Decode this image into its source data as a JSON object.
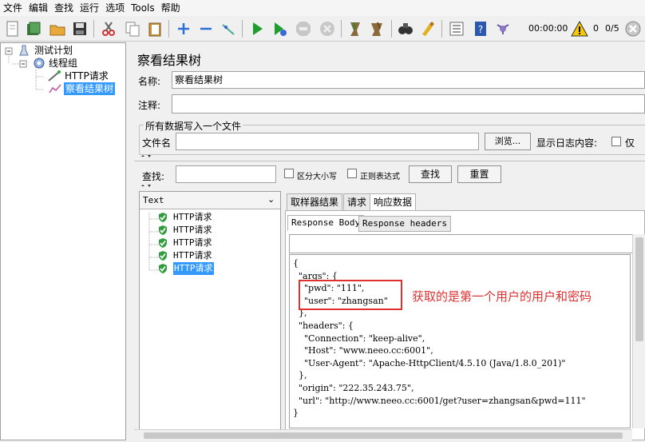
{
  "menu": [
    "文件",
    "编辑",
    "查找",
    "运行",
    "选项",
    "Tools",
    "帮助"
  ],
  "toolbar": {
    "timer": "00:00:00",
    "warnings": "0",
    "threads": "0/5"
  },
  "tree": {
    "plan": "测试计划",
    "thread_group": "线程组",
    "http_request": "HTTP请求",
    "result_tree": "察看结果树"
  },
  "panel": {
    "title": "察看结果树",
    "name_label": "名称:",
    "name_value": "察看结果树",
    "comment_label": "注释:",
    "write_all_label": "所有数据写入一个文件",
    "filename_label": "文件名",
    "browse_label": "浏览...",
    "log_label": "显示日志内容:",
    "log_option": "仅",
    "search_label": "查找:",
    "case_label": "区分大小写",
    "regex_label": "正则表达式",
    "find_btn": "查找",
    "reset_btn": "重置",
    "renderer": "Text"
  },
  "results": [
    "HTTP请求",
    "HTTP请求",
    "HTTP请求",
    "HTTP请求",
    "HTTP请求"
  ],
  "tabs": [
    "取样器结果",
    "请求",
    "响应数据"
  ],
  "subtabs": [
    "Response Body",
    "Response headers"
  ],
  "json_lines": [
    "{",
    "  \"args\": {",
    "    \"pwd\": \"111\",",
    "    \"user\": \"zhangsan\"",
    "  },",
    "  \"headers\": {",
    "    \"Connection\": \"keep-alive\",",
    "    \"Host\": \"www.neeo.cc:6001\",",
    "    \"User-Agent\": \"Apache-HttpClient/4.5.10 (Java/1.8.0_201)\"",
    "  },",
    "  \"origin\": \"222.35.243.75\",",
    "  \"url\": \"http://www.neeo.cc:6001/get?user=zhangsan&pwd=111\"",
    "}"
  ],
  "annotation": "获取的是第一个用户的用户和密码",
  "colors": {
    "selection": "#3399ff",
    "annotation": "#e03030",
    "check_green": "#2e9e3a"
  }
}
